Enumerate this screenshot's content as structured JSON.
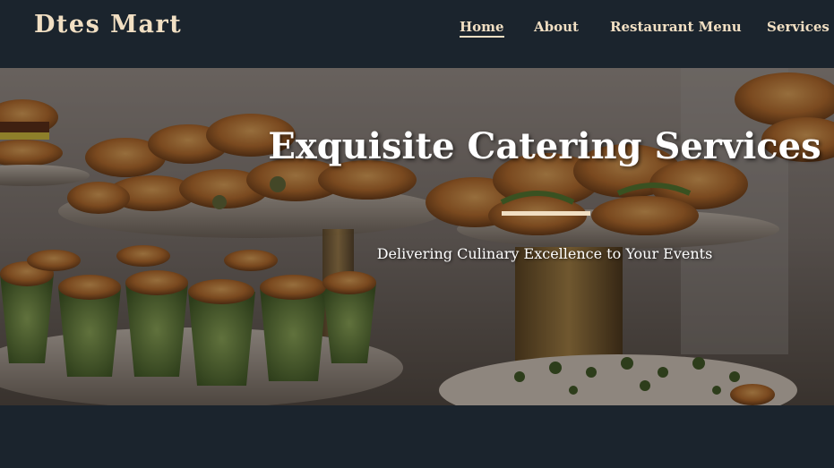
{
  "header": {
    "brand": "Dtes Mart",
    "nav": [
      {
        "label": "Home",
        "active": true
      },
      {
        "label": "About",
        "active": false
      },
      {
        "label": "Restaurant Menu",
        "active": false
      },
      {
        "label": "Services",
        "active": false
      }
    ]
  },
  "hero": {
    "title": "Exquisite Catering Services",
    "subtitle": "Delivering Culinary Excellence to Your Events",
    "image_description_icon": "catering-food-photo"
  },
  "colors": {
    "background": "#1b242d",
    "accent": "#f1dfc3",
    "hero_text": "#ffffff"
  }
}
